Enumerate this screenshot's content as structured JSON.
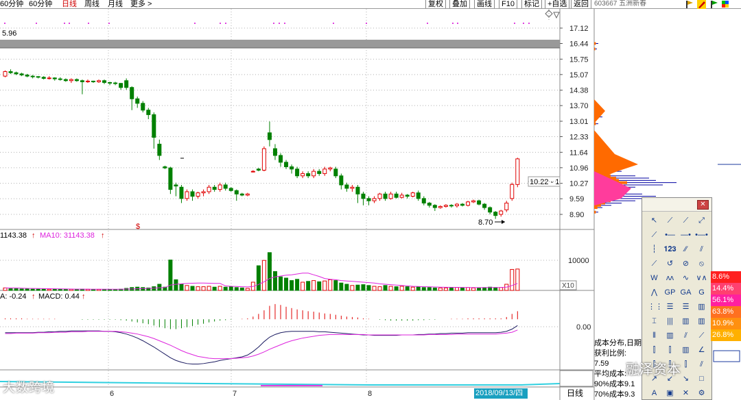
{
  "toolbar": {
    "left_items": [
      "60分钟",
      "60分钟",
      "日线",
      "周线",
      "月线",
      "更多 >"
    ],
    "active_index": 2,
    "right_buttons": [
      "复权",
      "叠加",
      "画线",
      "F10",
      "标记",
      "+自选",
      "返回"
    ],
    "stock": "603667 五洲新春"
  },
  "price_axis": [
    "17.12",
    "16.44",
    "15.75",
    "15.07",
    "14.38",
    "13.70",
    "13.01",
    "12.33",
    "11.64",
    "10.96",
    "10.27",
    "9.59",
    "8.90"
  ],
  "annotations": {
    "left_price": "5.96",
    "low_label": "8.70",
    "current_label": "10.22 - 1",
    "event_marker": "$"
  },
  "volume": {
    "legend_vol": "1143.38",
    "legend_ma10": "MA10: 31143.38",
    "tick": "10000",
    "scale": "X10"
  },
  "macd": {
    "legend_dif": "A: -0.24",
    "legend_macd": "MACD: 0.44",
    "tick": "0.00"
  },
  "months": [
    "6",
    "7",
    "8"
  ],
  "date_badge": "2018/09/13/四",
  "period": "日线",
  "info_panel": [
    "成本分布,日期",
    "获利比例:",
    "7.59",
    "平均成本:",
    "90%成本9.1",
    "70%成本9.3"
  ],
  "percent_badges": [
    {
      "text": "8.6%",
      "color": "#ff2020"
    },
    {
      "text": "14.4%",
      "color": "#ff4070"
    },
    {
      "text": "56.1%",
      "color": "#ff20a0"
    },
    {
      "text": "63.8%",
      "color": "#ff7020"
    },
    {
      "text": "10.9%",
      "color": "#ff9010"
    },
    {
      "text": "26.8%",
      "color": "#ffb000"
    }
  ],
  "watermarks": {
    "left": "大数跨境",
    "right": "融泽资本"
  },
  "colors": {
    "up": "#e00000",
    "down": "#008000",
    "ma": "#dd22dd",
    "grid": "#b0b0b0",
    "chip": "#ff6a00",
    "chip_pink": "#ff3c9c",
    "chip_blue": "#0000a0"
  },
  "chart_data": {
    "type": "candlestick",
    "y_range": [
      8.9,
      17.12
    ],
    "candles": [
      [
        15.0,
        15.2,
        15.25,
        14.95
      ],
      [
        15.2,
        15.15,
        15.3,
        15.1
      ],
      [
        15.15,
        15.1,
        15.2,
        15.05
      ],
      [
        15.1,
        15.05,
        15.15,
        15.0
      ],
      [
        15.05,
        15.0,
        15.1,
        14.95
      ],
      [
        15.0,
        14.98,
        15.05,
        14.9
      ],
      [
        14.98,
        14.95,
        15.0,
        14.9
      ],
      [
        14.95,
        14.9,
        15.0,
        14.85
      ],
      [
        14.9,
        14.92,
        15.0,
        14.85
      ],
      [
        14.92,
        14.88,
        14.95,
        14.8
      ],
      [
        14.88,
        14.85,
        14.95,
        14.8
      ],
      [
        14.85,
        14.8,
        14.9,
        14.75
      ],
      [
        14.8,
        14.85,
        14.9,
        14.7
      ],
      [
        14.85,
        14.8,
        14.9,
        14.75
      ],
      [
        14.8,
        14.75,
        14.85,
        14.2
      ],
      [
        14.75,
        14.78,
        14.85,
        14.7
      ],
      [
        14.78,
        14.75,
        14.8,
        14.7
      ],
      [
        14.75,
        14.8,
        14.85,
        14.7
      ],
      [
        14.8,
        14.72,
        14.85,
        14.65
      ],
      [
        14.72,
        14.7,
        14.75,
        14.6
      ],
      [
        14.7,
        14.68,
        14.75,
        14.6
      ],
      [
        14.68,
        14.5,
        14.7,
        14.4
      ],
      [
        14.8,
        14.5,
        14.9,
        14.4
      ],
      [
        14.5,
        14.0,
        14.55,
        13.5
      ],
      [
        14.0,
        13.8,
        14.1,
        13.6
      ],
      [
        13.8,
        13.5,
        13.9,
        13.4
      ],
      [
        13.5,
        13.3,
        13.6,
        13.1
      ],
      [
        13.3,
        12.3,
        13.4,
        11.8
      ],
      [
        12.0,
        11.5,
        12.2,
        11.3
      ],
      [
        11.0,
        10.95,
        11.05,
        10.9
      ],
      [
        10.95,
        10.0,
        11.0,
        9.8
      ],
      [
        10.2,
        10.15,
        10.3,
        9.7
      ],
      [
        10.1,
        9.6,
        10.2,
        9.4
      ],
      [
        9.6,
        9.9,
        10.0,
        9.5
      ],
      [
        9.9,
        9.7,
        10.0,
        9.5
      ],
      [
        9.7,
        9.85,
        9.9,
        9.6
      ],
      [
        9.85,
        9.9,
        10.0,
        9.7
      ],
      [
        9.9,
        10.1,
        10.2,
        9.8
      ],
      [
        10.1,
        10.0,
        10.2,
        9.9
      ],
      [
        10.0,
        10.2,
        10.3,
        9.9
      ],
      [
        10.2,
        10.05,
        10.3,
        9.95
      ],
      [
        10.05,
        9.95,
        10.1,
        9.9
      ],
      [
        9.95,
        9.8,
        10.0,
        9.5
      ],
      [
        9.8,
        9.75,
        9.85,
        9.7
      ],
      [
        9.75,
        9.8,
        9.85,
        9.7
      ],
      [
        10.8,
        10.8,
        10.85,
        10.75
      ],
      [
        10.9,
        10.85,
        10.95,
        10.8
      ],
      [
        10.85,
        11.8,
        11.9,
        10.8
      ],
      [
        12.5,
        12.2,
        13.0,
        11.9
      ],
      [
        11.8,
        11.5,
        12.0,
        11.3
      ],
      [
        11.5,
        11.2,
        11.6,
        11.0
      ],
      [
        11.2,
        11.0,
        11.3,
        10.9
      ],
      [
        11.0,
        10.9,
        11.1,
        10.7
      ],
      [
        10.9,
        10.6,
        11.0,
        10.5
      ],
      [
        10.6,
        10.7,
        10.8,
        10.5
      ],
      [
        10.7,
        10.6,
        10.8,
        10.5
      ],
      [
        10.6,
        10.8,
        10.9,
        10.5
      ],
      [
        10.8,
        10.7,
        10.9,
        10.6
      ],
      [
        10.7,
        10.9,
        11.0,
        10.6
      ],
      [
        10.9,
        10.95,
        11.0,
        10.8
      ],
      [
        10.9,
        10.6,
        11.0,
        10.5
      ],
      [
        10.6,
        10.2,
        10.7,
        10.0
      ],
      [
        10.2,
        10.05,
        10.3,
        9.9
      ],
      [
        10.05,
        10.1,
        10.2,
        9.9
      ],
      [
        10.1,
        9.8,
        10.2,
        9.4
      ],
      [
        9.8,
        9.6,
        9.9,
        9.3
      ],
      [
        9.6,
        9.5,
        9.7,
        9.3
      ],
      [
        9.5,
        9.6,
        9.7,
        9.4
      ],
      [
        9.6,
        9.8,
        9.85,
        9.5
      ],
      [
        9.8,
        9.6,
        9.9,
        9.5
      ],
      [
        9.6,
        9.8,
        9.9,
        9.55
      ],
      [
        9.8,
        9.65,
        9.9,
        9.6
      ],
      [
        9.65,
        9.75,
        9.85,
        9.6
      ],
      [
        9.75,
        9.7,
        9.8,
        9.6
      ],
      [
        9.7,
        9.85,
        9.9,
        9.65
      ],
      [
        9.85,
        9.6,
        9.95,
        9.5
      ],
      [
        9.6,
        9.4,
        9.7,
        9.3
      ],
      [
        9.4,
        9.3,
        9.45,
        9.2
      ],
      [
        9.3,
        9.2,
        9.35,
        9.05
      ],
      [
        9.2,
        9.25,
        9.3,
        9.15
      ],
      [
        9.25,
        9.3,
        9.35,
        9.2
      ],
      [
        9.3,
        9.28,
        9.35,
        9.2
      ],
      [
        9.28,
        9.35,
        9.4,
        9.2
      ],
      [
        9.35,
        9.3,
        9.4,
        9.25
      ],
      [
        9.3,
        9.45,
        9.5,
        9.25
      ],
      [
        9.45,
        9.5,
        9.55,
        9.4
      ],
      [
        9.5,
        9.35,
        9.55,
        9.3
      ],
      [
        9.35,
        9.2,
        9.4,
        9.1
      ],
      [
        9.2,
        9.0,
        9.25,
        8.9
      ],
      [
        9.0,
        8.85,
        9.05,
        8.7
      ],
      [
        8.9,
        9.05,
        9.1,
        8.8
      ],
      [
        9.1,
        9.4,
        9.5,
        9.0
      ],
      [
        9.6,
        10.22,
        10.3,
        9.5
      ],
      [
        10.22,
        11.35,
        11.4,
        10.1
      ]
    ],
    "volume": [
      600,
      400,
      400,
      350,
      350,
      300,
      300,
      300,
      300,
      300,
      280,
      280,
      280,
      260,
      300,
      280,
      260,
      260,
      260,
      240,
      240,
      300,
      500,
      700,
      800,
      700,
      600,
      900,
      1500,
      800,
      7400,
      2600,
      1500,
      1200,
      1000,
      900,
      900,
      1000,
      800,
      1000,
      800,
      900,
      700,
      600,
      500,
      2000,
      6000,
      7300,
      9200,
      4600,
      3300,
      3000,
      2400,
      2700,
      2000,
      2200,
      2400,
      2100,
      2300,
      2600,
      2400,
      1800,
      1500,
      1200,
      1300,
      1400,
      1200,
      1000,
      900,
      1200,
      1000,
      900,
      1000,
      900,
      800,
      900,
      700,
      700,
      600,
      600,
      600,
      600,
      700,
      600,
      700,
      600,
      600,
      700,
      800,
      700,
      700,
      1500,
      5100,
      5200
    ],
    "ma10_volume": [
      600,
      600,
      600,
      550,
      500,
      480,
      460,
      440,
      420,
      400,
      380,
      360,
      340,
      320,
      310,
      300,
      300,
      290,
      290,
      290,
      290,
      300,
      330,
      360,
      400,
      440,
      480,
      550,
      650,
      700,
      1300,
      1500,
      1600,
      1700,
      1750,
      1800,
      1800,
      1750,
      1700,
      1700,
      1100,
      1000,
      950,
      900,
      850,
      950,
      1450,
      2100,
      2900,
      3300,
      3500,
      3700,
      3800,
      4000,
      4200,
      4200,
      3800,
      3400,
      2900,
      2700,
      2600,
      2400,
      2300,
      2200,
      2100,
      2000,
      1900,
      1800,
      1600,
      1500,
      1400,
      1300,
      1200,
      1100,
      1000,
      950,
      900,
      870,
      840,
      800,
      780,
      760,
      740,
      720,
      700,
      690,
      680,
      690,
      700,
      710,
      720,
      800,
      1200,
      1700
    ],
    "macd_hist": [
      0.02,
      0.02,
      0.02,
      0.02,
      0.01,
      0.01,
      0.01,
      0.01,
      0.01,
      0.01,
      0.0,
      0.0,
      0.0,
      0.0,
      -0.01,
      -0.01,
      -0.01,
      -0.01,
      -0.01,
      -0.01,
      -0.01,
      -0.02,
      -0.03,
      -0.05,
      -0.07,
      -0.09,
      -0.11,
      -0.14,
      -0.18,
      -0.2,
      -0.22,
      -0.22,
      -0.2,
      -0.18,
      -0.15,
      -0.12,
      -0.1,
      -0.07,
      -0.05,
      -0.03,
      -0.02,
      -0.01,
      0.0,
      0.01,
      0.02,
      0.06,
      0.12,
      0.2,
      0.3,
      0.34,
      0.32,
      0.28,
      0.25,
      0.22,
      0.2,
      0.18,
      0.17,
      0.15,
      0.13,
      0.12,
      0.1,
      0.08,
      0.06,
      0.05,
      0.04,
      0.02,
      0.01,
      0.0,
      -0.01,
      -0.02,
      -0.03,
      -0.03,
      -0.03,
      -0.03,
      -0.03,
      -0.02,
      -0.02,
      -0.01,
      -0.01,
      0.0,
      0.0,
      0.01,
      0.01,
      0.01,
      0.02,
      0.02,
      0.02,
      0.02,
      0.02,
      0.02,
      0.02,
      0.05,
      0.12,
      0.18
    ],
    "dif": [
      -0.3,
      -0.3,
      -0.3,
      -0.3,
      -0.3,
      -0.3,
      -0.29,
      -0.29,
      -0.28,
      -0.28,
      -0.27,
      -0.27,
      -0.26,
      -0.26,
      -0.26,
      -0.26,
      -0.26,
      -0.26,
      -0.27,
      -0.27,
      -0.28,
      -0.3,
      -0.33,
      -0.37,
      -0.42,
      -0.48,
      -0.55,
      -0.62,
      -0.7,
      -0.78,
      -0.86,
      -0.92,
      -0.96,
      -0.99,
      -1.0,
      -1.0,
      -0.99,
      -0.97,
      -0.95,
      -0.92,
      -0.9,
      -0.88,
      -0.86,
      -0.84,
      -0.8,
      -0.72,
      -0.62,
      -0.5,
      -0.4,
      -0.34,
      -0.3,
      -0.28,
      -0.27,
      -0.27,
      -0.27,
      -0.27,
      -0.27,
      -0.28,
      -0.28,
      -0.29,
      -0.3,
      -0.31,
      -0.32,
      -0.33,
      -0.34,
      -0.35,
      -0.35,
      -0.36,
      -0.36,
      -0.36,
      -0.36,
      -0.36,
      -0.35,
      -0.35,
      -0.35,
      -0.34,
      -0.34,
      -0.33,
      -0.33,
      -0.32,
      -0.32,
      -0.31,
      -0.31,
      -0.31,
      -0.3,
      -0.3,
      -0.3,
      -0.3,
      -0.3,
      -0.3,
      -0.29,
      -0.27,
      -0.22,
      -0.14
    ],
    "dea": [
      -0.32,
      -0.32,
      -0.31,
      -0.31,
      -0.31,
      -0.31,
      -0.3,
      -0.3,
      -0.3,
      -0.29,
      -0.29,
      -0.29,
      -0.28,
      -0.28,
      -0.28,
      -0.27,
      -0.27,
      -0.27,
      -0.27,
      -0.27,
      -0.27,
      -0.28,
      -0.29,
      -0.31,
      -0.33,
      -0.36,
      -0.39,
      -0.43,
      -0.48,
      -0.53,
      -0.58,
      -0.64,
      -0.7,
      -0.75,
      -0.79,
      -0.83,
      -0.85,
      -0.87,
      -0.88,
      -0.88,
      -0.88,
      -0.88,
      -0.87,
      -0.86,
      -0.85,
      -0.82,
      -0.78,
      -0.73,
      -0.67,
      -0.62,
      -0.57,
      -0.52,
      -0.48,
      -0.45,
      -0.42,
      -0.4,
      -0.38,
      -0.36,
      -0.35,
      -0.34,
      -0.34,
      -0.34,
      -0.34,
      -0.34,
      -0.34,
      -0.34,
      -0.35,
      -0.35,
      -0.35,
      -0.35,
      -0.35,
      -0.35,
      -0.35,
      -0.35,
      -0.35,
      -0.35,
      -0.35,
      -0.34,
      -0.34,
      -0.34,
      -0.34,
      -0.34,
      -0.33,
      -0.33,
      -0.33,
      -0.33,
      -0.33,
      -0.33,
      -0.33,
      -0.33,
      -0.32,
      -0.31,
      -0.29,
      -0.24
    ],
    "volume_ylim": [
      0,
      12000
    ],
    "macd_ylim": [
      -1.1,
      0.4
    ]
  }
}
